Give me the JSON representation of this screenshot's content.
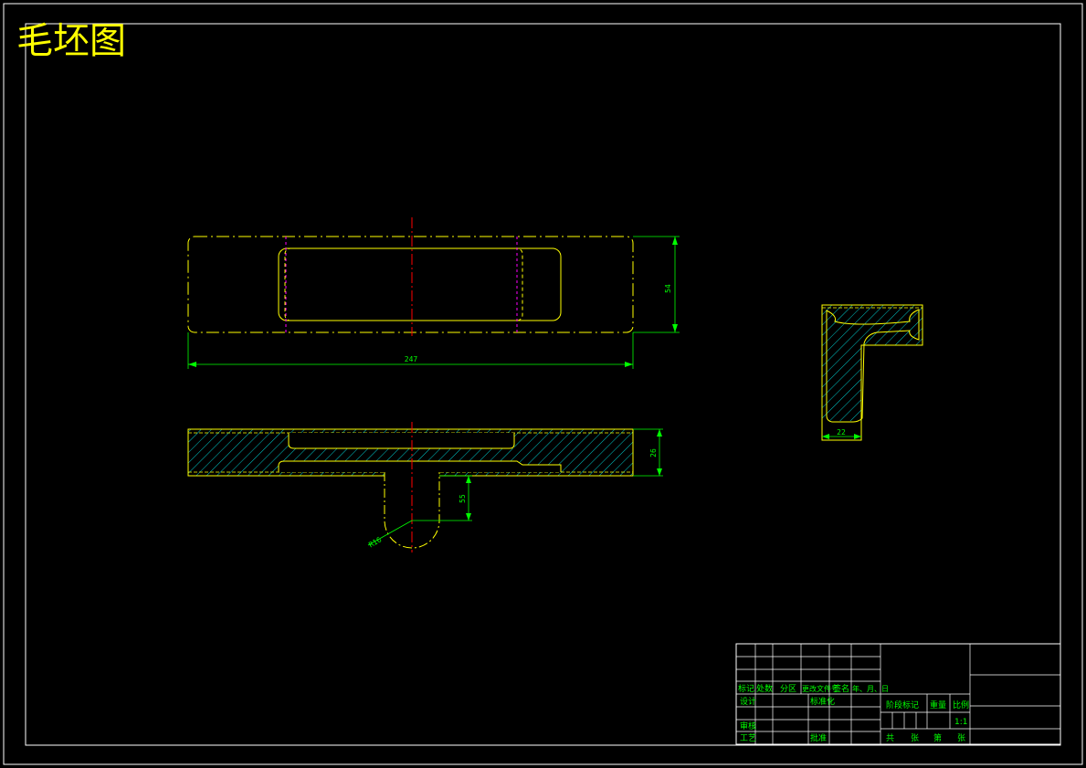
{
  "title": "毛坯图",
  "dimensions": {
    "length": "247",
    "width": "54",
    "thickness": "26",
    "boss_height": "55",
    "radius": "R16",
    "side_width": "22"
  },
  "title_block": {
    "mark": "标记",
    "count": "处数",
    "zone": "分区",
    "doc_no": "更改文件号",
    "signature": "签名",
    "date": "年、月、日",
    "design": "设计",
    "standardize": "标准化",
    "review": "审核",
    "process": "工艺",
    "approve": "批准",
    "stage_mark": "阶段标记",
    "weight": "重量",
    "scale_label": "比例",
    "scale": "1:1",
    "total_sheets": "共",
    "sheets_unit": "张",
    "sheet_no": "第",
    "sheet_unit": "张"
  },
  "colors": {
    "background": "#000000",
    "frame": "#ffffff",
    "outline": "#ffff00",
    "dimension": "#00ff00",
    "centerline": "#ff0000",
    "hidden": "#ff00ff",
    "hatch": "#00ffff"
  }
}
